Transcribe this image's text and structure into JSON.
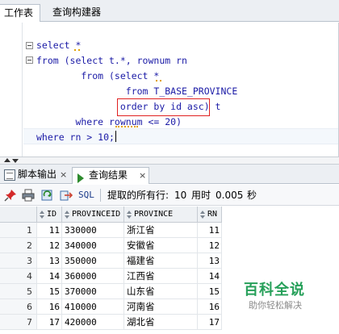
{
  "top_tabs": {
    "worksheet": "工作表",
    "query_builder": "查询构建器"
  },
  "editor": {
    "lines": [
      "select *",
      "from (select t.*, rownum rn",
      "        from (select *",
      "                from T_BASE_PROVINCE",
      "               order by id asc) t",
      "       where rownum <= 20)",
      "where rn > 10;"
    ],
    "highlight_color": "#e02020"
  },
  "bottom_tabs": {
    "script_output": "脚本输出",
    "query_result": "查询结果",
    "close_glyph": "×"
  },
  "toolbar": {
    "sql_label": "SQL",
    "fetched_label": "提取的所有行:",
    "fetched_rows": "10",
    "time_label": "用时",
    "time_value": "0.005",
    "time_unit": "秒",
    "icons": [
      "pin-icon",
      "print-icon",
      "refresh-icon",
      "export-icon"
    ]
  },
  "grid": {
    "columns": [
      "ID",
      "PROVINCEID",
      "PROVINCE",
      "RN"
    ],
    "rows": [
      {
        "num": "1",
        "id": "11",
        "provinceid": "330000",
        "province": "浙江省",
        "rn": "11"
      },
      {
        "num": "2",
        "id": "12",
        "provinceid": "340000",
        "province": "安徽省",
        "rn": "12"
      },
      {
        "num": "3",
        "id": "13",
        "provinceid": "350000",
        "province": "福建省",
        "rn": "13"
      },
      {
        "num": "4",
        "id": "14",
        "provinceid": "360000",
        "province": "江西省",
        "rn": "14"
      },
      {
        "num": "5",
        "id": "15",
        "provinceid": "370000",
        "province": "山东省",
        "rn": "15"
      },
      {
        "num": "6",
        "id": "16",
        "provinceid": "410000",
        "province": "河南省",
        "rn": "16"
      },
      {
        "num": "7",
        "id": "17",
        "provinceid": "420000",
        "province": "湖北省",
        "rn": "17"
      }
    ]
  },
  "watermark": {
    "title": "百科全说",
    "subtitle": "助你轻松解决",
    "color": "#27a05a"
  }
}
